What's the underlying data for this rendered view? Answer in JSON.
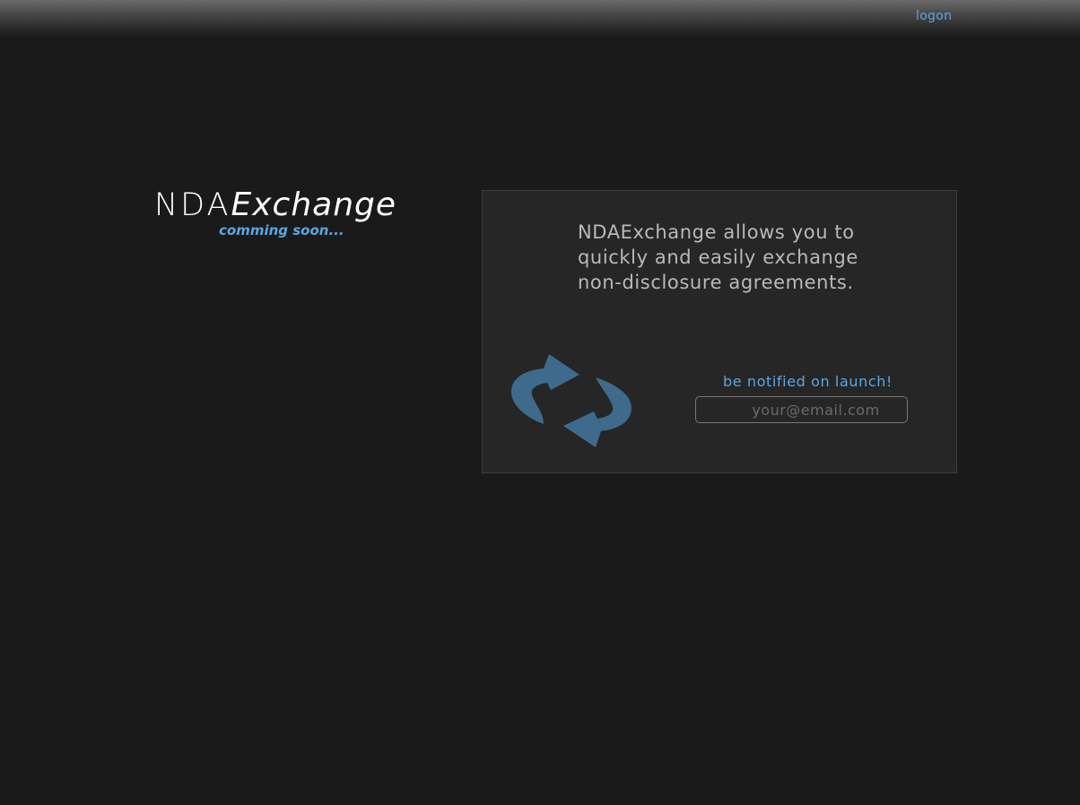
{
  "header": {
    "logon_label": "logon"
  },
  "logo": {
    "prefix": "NDA",
    "suffix": "Exchange",
    "tagline": "comming soon..."
  },
  "panel": {
    "description": "NDAExchange allows you to\nquickly and easily exchange\nnon-disclosure agreements.",
    "icon": "exchange-arrows-icon",
    "notify": {
      "label": "be notified on launch!",
      "email_placeholder": "your@email.com",
      "email_value": ""
    }
  },
  "colors": {
    "background": "#1a1a1a",
    "panel_background": "#262626",
    "accent_blue": "#5aa7e0",
    "icon_blue": "#3e6a8c",
    "text_gray": "#b9b9b9"
  }
}
